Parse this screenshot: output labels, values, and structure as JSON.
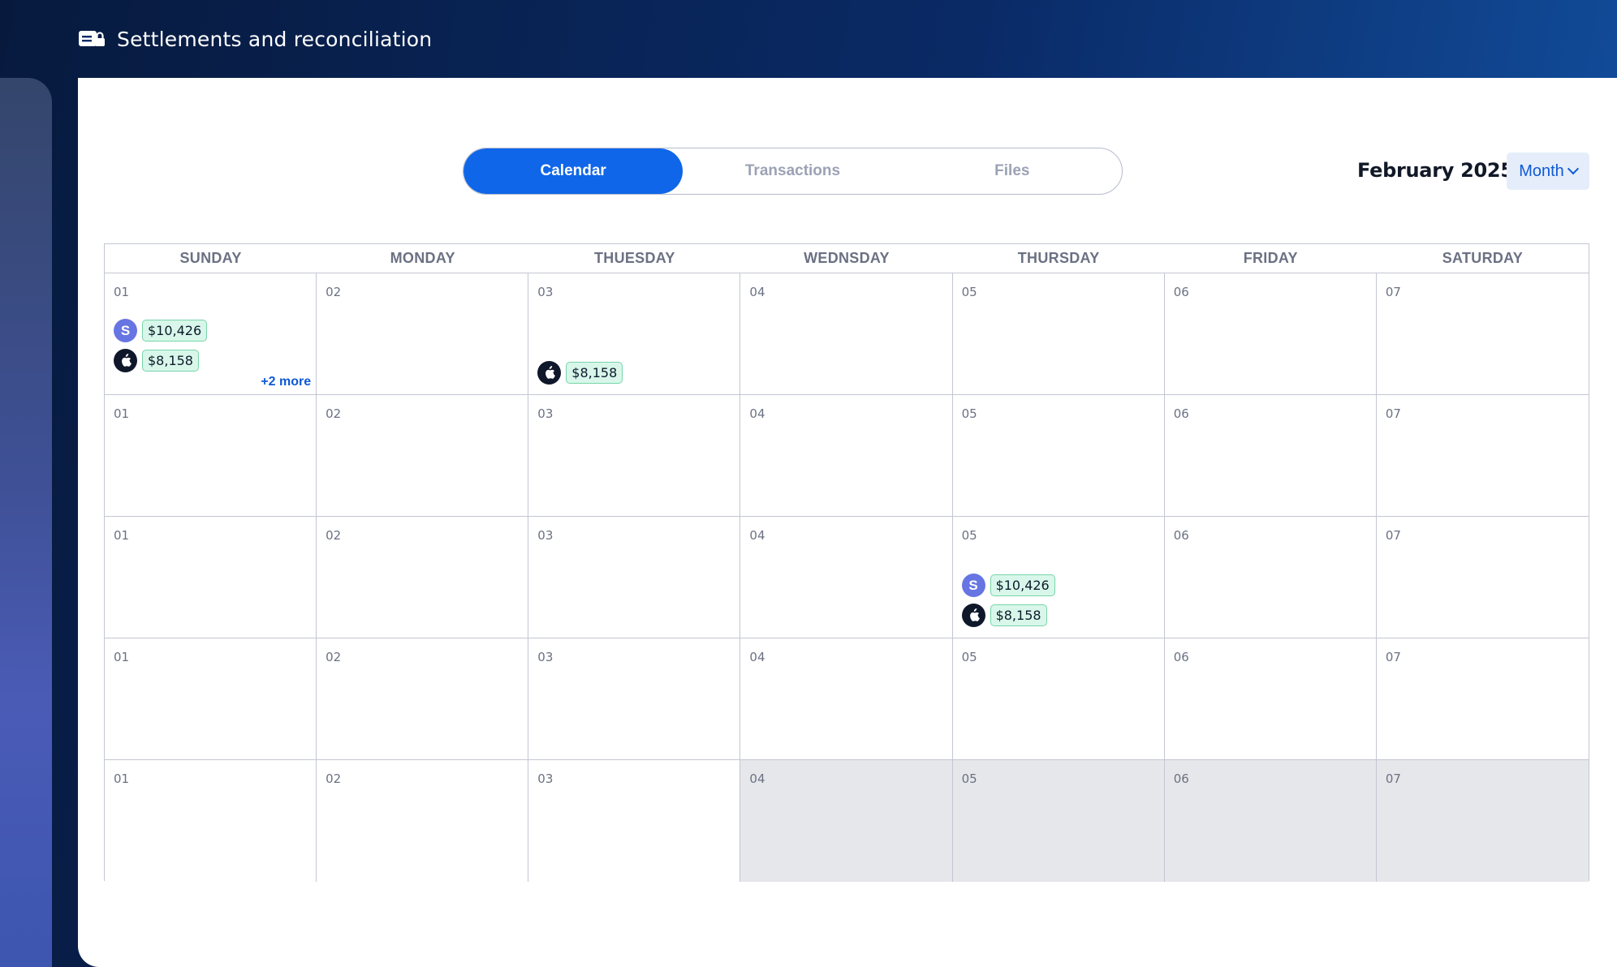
{
  "app": {
    "title": "Settlements and reconciliation",
    "icon": "settlements-wallet-icon"
  },
  "tabs": [
    {
      "label": "Calendar",
      "active": true
    },
    {
      "label": "Transactions",
      "active": false
    },
    {
      "label": "Files",
      "active": false
    }
  ],
  "period": {
    "label": "February 2025"
  },
  "view_select": {
    "value": "Month"
  },
  "weekdays": [
    "SUNDAY",
    "MONDAY",
    "THUESDAY",
    "WEDNSDAY",
    "THURSDAY",
    "FRIDAY",
    "SATURDAY"
  ],
  "weeks": [
    [
      {
        "date": "01",
        "events": [
          {
            "provider": "stripe",
            "badge": "S",
            "amount": "$10,426"
          },
          {
            "provider": "apple",
            "badge": "apple-icon",
            "amount": "$8,158"
          }
        ],
        "more": "+2 more"
      },
      {
        "date": "02"
      },
      {
        "date": "03",
        "events": [
          {
            "provider": "apple",
            "badge": "apple-icon",
            "amount": "$8,158"
          }
        ]
      },
      {
        "date": "04"
      },
      {
        "date": "05"
      },
      {
        "date": "06"
      },
      {
        "date": "07"
      }
    ],
    [
      {
        "date": "01"
      },
      {
        "date": "02"
      },
      {
        "date": "03"
      },
      {
        "date": "04"
      },
      {
        "date": "05"
      },
      {
        "date": "06"
      },
      {
        "date": "07"
      }
    ],
    [
      {
        "date": "01"
      },
      {
        "date": "02"
      },
      {
        "date": "03"
      },
      {
        "date": "04"
      },
      {
        "date": "05",
        "events": [
          {
            "provider": "stripe",
            "badge": "S",
            "amount": "$10,426"
          },
          {
            "provider": "apple",
            "badge": "apple-icon",
            "amount": "$8,158"
          }
        ]
      },
      {
        "date": "06"
      },
      {
        "date": "07"
      }
    ],
    [
      {
        "date": "01"
      },
      {
        "date": "02"
      },
      {
        "date": "03"
      },
      {
        "date": "04"
      },
      {
        "date": "05"
      },
      {
        "date": "06"
      },
      {
        "date": "07"
      }
    ],
    [
      {
        "date": "01"
      },
      {
        "date": "02"
      },
      {
        "date": "03"
      },
      {
        "date": "04",
        "disabled": true
      },
      {
        "date": "05",
        "disabled": true
      },
      {
        "date": "06",
        "disabled": true
      },
      {
        "date": "07",
        "disabled": true
      }
    ]
  ],
  "colors": {
    "accent": "#0f66e8",
    "stripe": "#6775e2",
    "apple": "#0f172a",
    "amount_bg": "#d8f7ea",
    "amount_border": "#78d4a9",
    "disabled_cell": "#e6e7ea"
  }
}
